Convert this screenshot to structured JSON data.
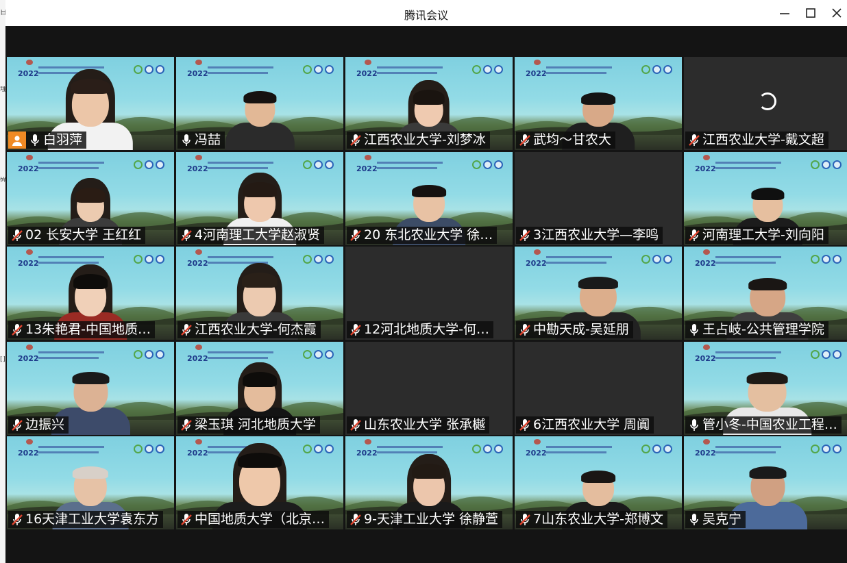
{
  "window": {
    "title": "腾讯会议"
  },
  "edge_chars": [
    "日",
    "埋",
    "碎",
    "[]"
  ],
  "colors": {
    "host_badge": "#f08a24",
    "muted_mic": "#e0452f",
    "background": "#141414"
  },
  "participants": [
    {
      "name": "白羽萍",
      "mic": "on",
      "host": true,
      "video": true
    },
    {
      "name": "冯喆",
      "mic": "on",
      "video": true
    },
    {
      "name": "江西农业大学-刘梦冰",
      "mic": "muted",
      "video": true
    },
    {
      "name": "武均～甘农大",
      "mic": "muted",
      "video": true
    },
    {
      "name": "江西农业大学-戴文超",
      "mic": "muted",
      "video": false,
      "loading": true
    },
    {
      "name": "02 长安大学 王红红",
      "mic": "muted",
      "video": true
    },
    {
      "name": "4河南理工大学赵淑贤",
      "mic": "muted",
      "video": true
    },
    {
      "name": "20 东北农业大学 徐…",
      "mic": "muted",
      "video": true
    },
    {
      "name": "3江西农业大学—李鸣",
      "mic": "muted",
      "video": false
    },
    {
      "name": "河南理工大学-刘向阳",
      "mic": "muted",
      "video": true
    },
    {
      "name": "13朱艳君-中国地质…",
      "mic": "muted",
      "video": true
    },
    {
      "name": "江西农业大学-何杰霞",
      "mic": "muted",
      "video": true
    },
    {
      "name": "12河北地质大学-何…",
      "mic": "muted",
      "video": false
    },
    {
      "name": "中勘天成-吴延朋",
      "mic": "muted",
      "video": true
    },
    {
      "name": "王占岐-公共管理学院",
      "mic": "on",
      "video": true
    },
    {
      "name": "边振兴",
      "mic": "muted",
      "video": true
    },
    {
      "name": "梁玉琪 河北地质大学",
      "mic": "muted",
      "video": true
    },
    {
      "name": "山东农业大学 张承樾",
      "mic": "muted",
      "video": false
    },
    {
      "name": "6江西农业大学 周阗",
      "mic": "muted",
      "video": false
    },
    {
      "name": "管小冬-中国农业工程…",
      "mic": "on",
      "video": true
    },
    {
      "name": "16天津工业大学袁东方",
      "mic": "muted",
      "video": true
    },
    {
      "name": "中国地质大学（北京…",
      "mic": "muted",
      "video": true
    },
    {
      "name": "9-天津工业大学 徐静萱",
      "mic": "muted",
      "video": true
    },
    {
      "name": "7山东农业大学-郑博文",
      "mic": "muted",
      "video": true
    },
    {
      "name": "吴克宁",
      "mic": "on",
      "video": true
    }
  ],
  "banner": {
    "year": "2022"
  }
}
